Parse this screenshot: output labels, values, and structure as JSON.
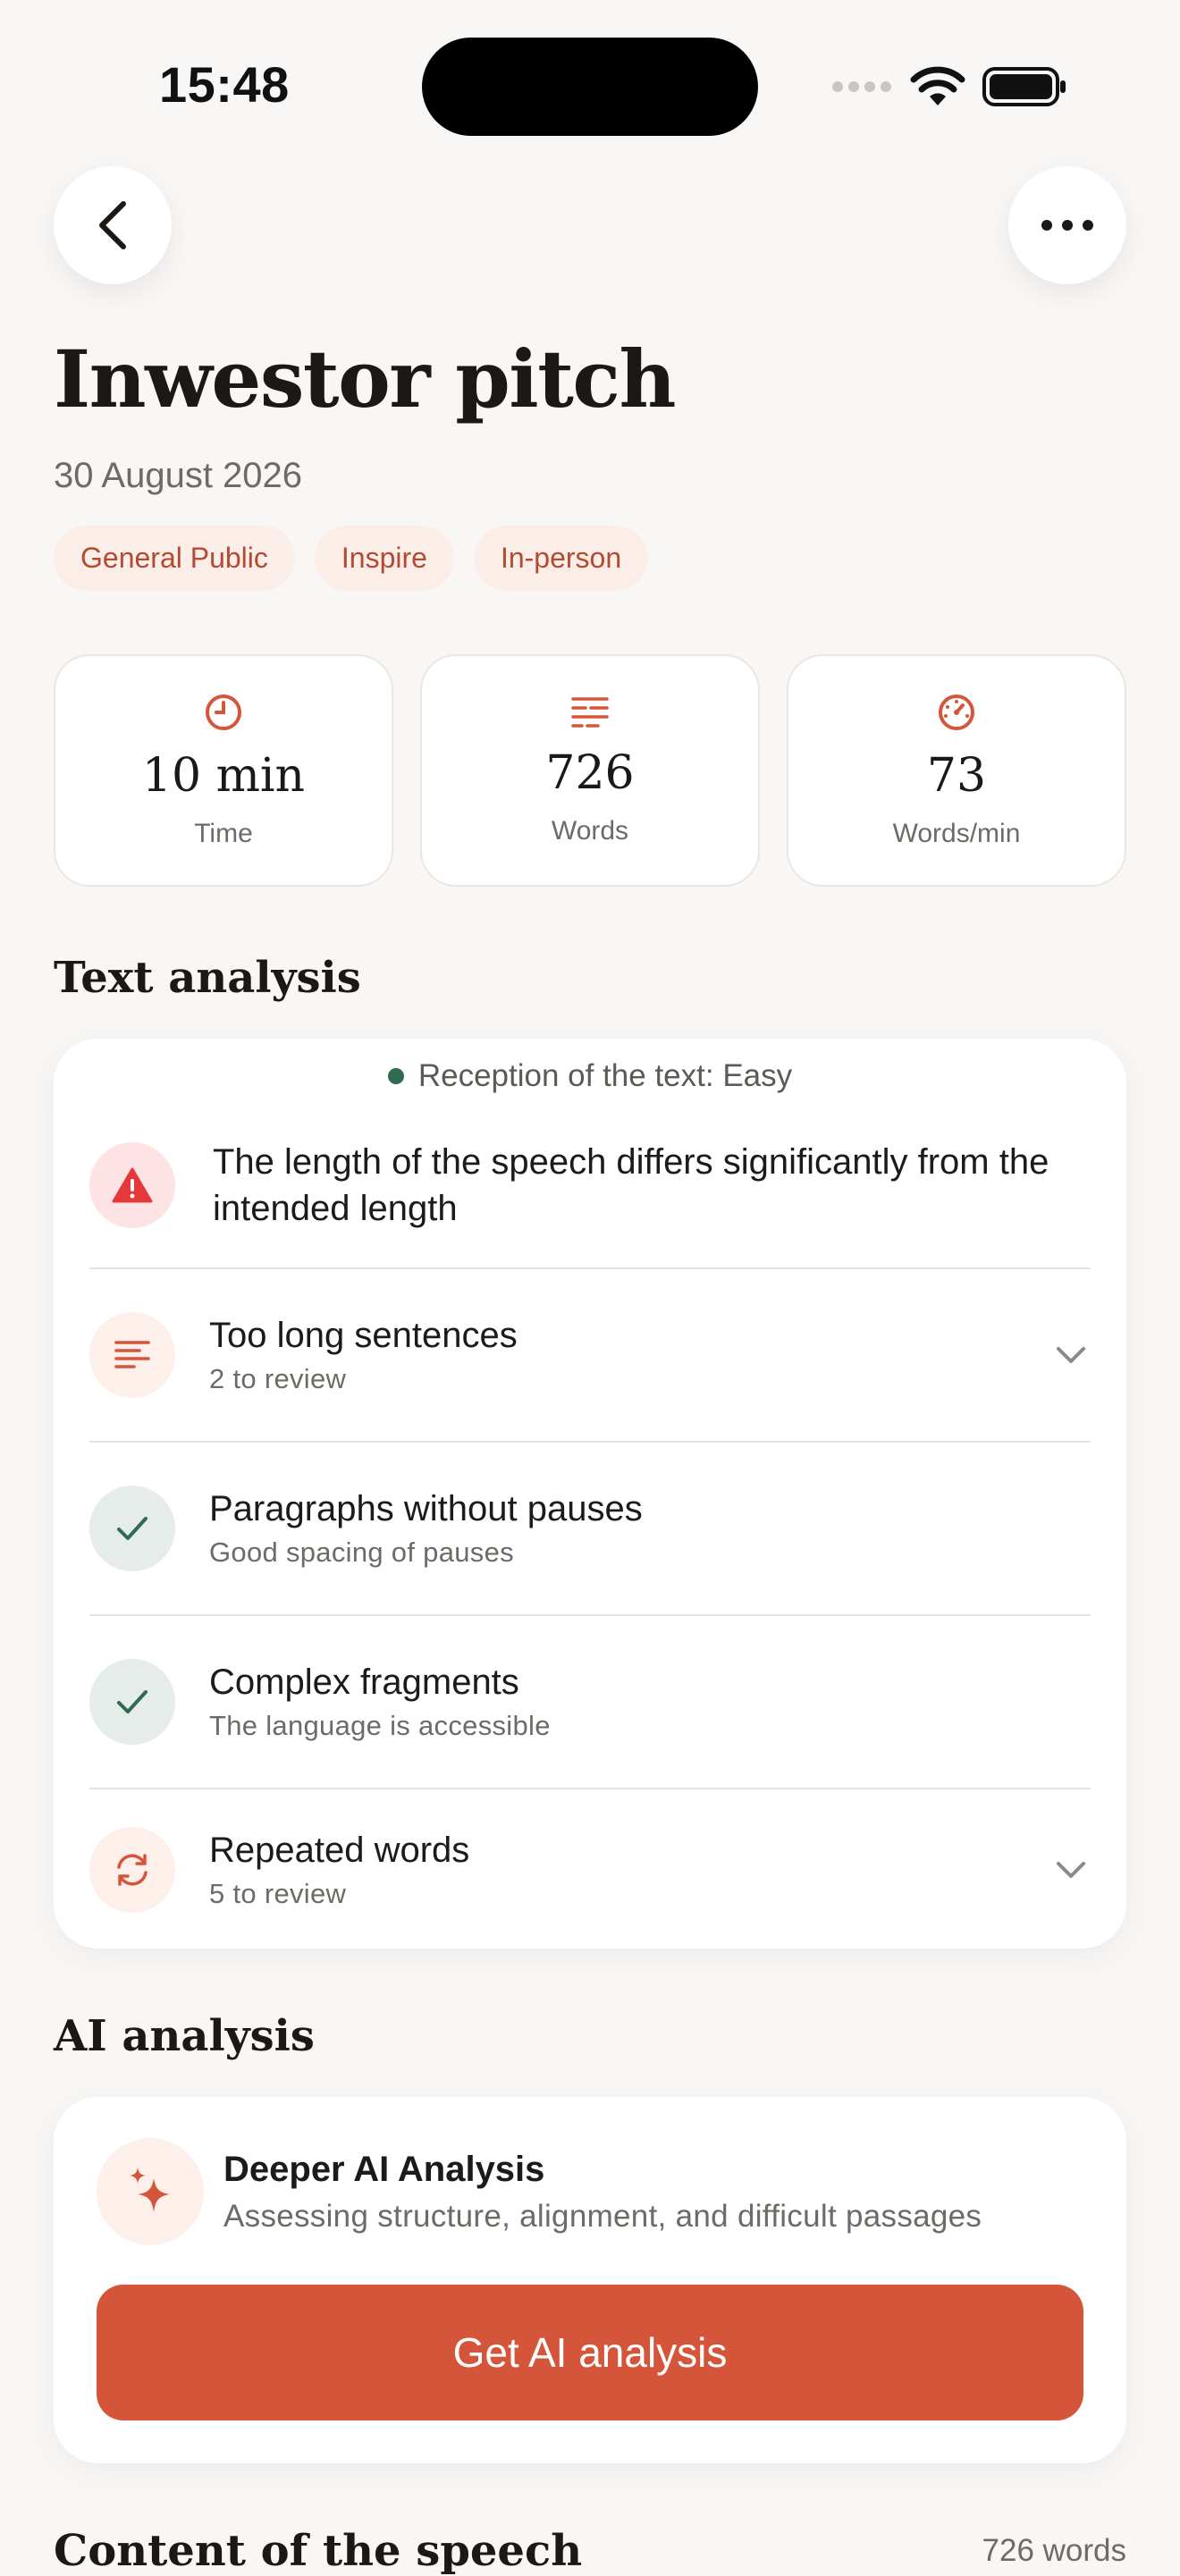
{
  "status": {
    "time": "15:48"
  },
  "header": {
    "title": "Inwestor pitch",
    "date": "30 August 2026"
  },
  "tags": [
    "General Public",
    "Inspire",
    "In-person"
  ],
  "stats": [
    {
      "icon": "clock-icon",
      "value": "10 min",
      "label": "Time"
    },
    {
      "icon": "text-lines-icon",
      "value": "726",
      "label": "Words"
    },
    {
      "icon": "speedometer-icon",
      "value": "73",
      "label": "Words/min"
    }
  ],
  "text_analysis": {
    "title": "Text analysis",
    "reception": "Reception of the text: Easy",
    "warning": "The length of the speech differs significantly from the intended length",
    "items": [
      {
        "title": "Too long sentences",
        "subtitle": "2 to review",
        "status": "review",
        "icon": "lines-icon"
      },
      {
        "title": "Paragraphs without pauses",
        "subtitle": "Good spacing of pauses",
        "status": "ok",
        "icon": "check-icon"
      },
      {
        "title": "Complex fragments",
        "subtitle": "The language is accessible",
        "status": "ok",
        "icon": "check-icon"
      },
      {
        "title": "Repeated words",
        "subtitle": "5 to review",
        "status": "review",
        "icon": "refresh-icon"
      }
    ]
  },
  "ai_analysis": {
    "title": "AI analysis",
    "card_title": "Deeper AI Analysis",
    "card_subtitle": "Assessing structure, alignment, and difficult passages",
    "button_label": "Get AI analysis"
  },
  "content": {
    "title": "Content of the speech",
    "word_count": "726 words"
  },
  "colors": {
    "accent": "#d5553a",
    "ok": "#2f6b4e",
    "warning": "#e5383b",
    "background": "#f9f7f5"
  }
}
